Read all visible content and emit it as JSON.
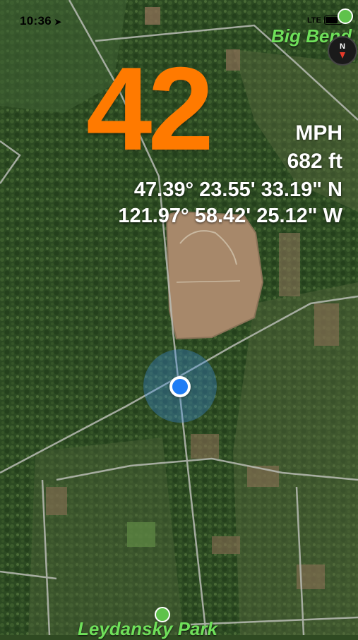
{
  "status_bar": {
    "time": "10:36",
    "network": "LTE",
    "location_arrow_icon": "navigation-arrow-icon"
  },
  "speed": {
    "value": "42",
    "unit": "MPH",
    "color": "#ff7a00"
  },
  "altitude": "682 ft",
  "coordinates": {
    "latitude": "47.39° 23.55' 33.19\" N",
    "longitude": "121.97° 58.42' 25.12\" W"
  },
  "map": {
    "places": [
      "Big Bend",
      "Leydansky Park"
    ],
    "place_icon": "park-tree-icon",
    "compass_icon": "compass-icon",
    "location_marker": "current-location-icon"
  }
}
